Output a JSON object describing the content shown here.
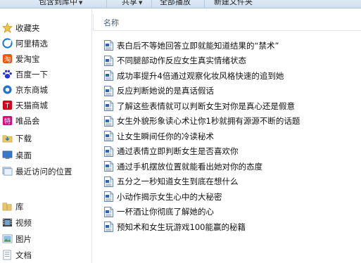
{
  "toolbar": {
    "items": [
      {
        "label": "包含到库中",
        "dropdown": true
      },
      {
        "label": "共享",
        "dropdown": true
      },
      {
        "label": "全部播放",
        "dropdown": false
      },
      {
        "label": "新建文件夹",
        "dropdown": false
      }
    ],
    "dropdown_glyph": "▼"
  },
  "nav": {
    "favorites": {
      "label": "收藏夹",
      "icon": "star-icon"
    },
    "items": [
      {
        "label": "阿里精选",
        "icon": "ali-icon",
        "color": "#1b78d8"
      },
      {
        "label": "爱淘宝",
        "icon": "taobao-icon",
        "color": "#ff5000"
      },
      {
        "label": "百度一下",
        "icon": "baidu-paw-icon",
        "color": "#2932e1"
      },
      {
        "label": "京东商城",
        "icon": "jd-icon",
        "color": "#1e73d6"
      },
      {
        "label": "天猫商城",
        "icon": "tmall-icon",
        "color": "#d9001b"
      },
      {
        "label": "唯品会",
        "icon": "vip-icon",
        "color": "#e4007f"
      },
      {
        "label": "下载",
        "icon": "download-folder-icon",
        "color": "#3d7fd1"
      },
      {
        "label": "桌面",
        "icon": "desktop-icon",
        "color": "#3a78c8"
      },
      {
        "label": "最近访问的位置",
        "icon": "recent-places-icon",
        "color": "#6b8fb5"
      }
    ],
    "library": {
      "label": "库",
      "icon": "library-icon"
    },
    "library_items": [
      {
        "label": "视频",
        "icon": "video-library-icon"
      },
      {
        "label": "图片",
        "icon": "pictures-library-icon"
      },
      {
        "label": "文档",
        "icon": "documents-library-icon"
      }
    ]
  },
  "content": {
    "column_name": "名称",
    "file_icon": "wordpad-document-icon",
    "files": [
      "表白后不等她回答立即就能知道结果的“禁术”",
      "不同腿部动作反应女生真实情绪状态",
      "成功率提升4倍通过观察化妆风格快速的追到她",
      "反应判断她说的是真话假话",
      "了解这些表情就可以判断女生对你是真心还是假意",
      "女生外貌形象读心术让你1秒就拥有源源不断的话题",
      "让女生瞬间任你的冷读秘术",
      "通过表情立即判断女生是否喜欢你",
      "通过手机摆放位置就能看出她对你的态度",
      "五分之一秒知道女生到底在想什么",
      "小动作揭示女生心中的大秘密",
      "一杯酒让你彻底了解她的心",
      "预知术和女生玩游戏100能赢的秘籍"
    ]
  }
}
